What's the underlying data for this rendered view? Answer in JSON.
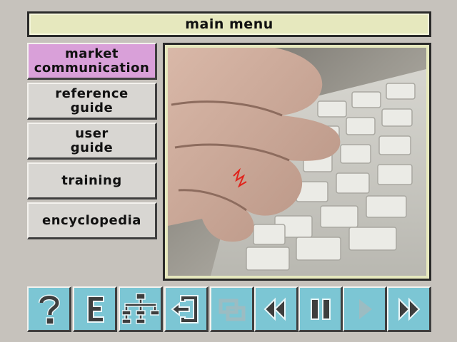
{
  "header": {
    "title": "main menu"
  },
  "menu": {
    "items": [
      {
        "label": "market\ncommunication",
        "selected": true
      },
      {
        "label": "reference\nguide",
        "selected": false
      },
      {
        "label": "user\nguide",
        "selected": false
      },
      {
        "label": "training",
        "selected": false
      },
      {
        "label": "encyclopedia",
        "selected": false
      }
    ]
  },
  "video": {
    "subject": "hand typing on keyboard"
  },
  "toolbar": {
    "buttons": [
      {
        "icon": "help-icon",
        "text": "?",
        "enabled": true
      },
      {
        "icon": "encyclopedia-icon",
        "text": "E",
        "enabled": true
      },
      {
        "icon": "hierarchy-map-icon",
        "enabled": true
      },
      {
        "icon": "exit-icon",
        "enabled": true
      },
      {
        "icon": "overlap-windows-icon",
        "enabled": false
      },
      {
        "icon": "rewind-icon",
        "enabled": true
      },
      {
        "icon": "pause-icon",
        "enabled": true
      },
      {
        "icon": "play-icon",
        "enabled": false
      },
      {
        "icon": "fast-forward-icon",
        "enabled": true
      }
    ]
  },
  "colors": {
    "background": "#c6c2bc",
    "title_fill": "#e6e8be",
    "selected_menu": "#d9a0d9",
    "menu_button": "#d8d6d2",
    "toolbar_button": "#7cc6d4",
    "icon_dark": "#3e3e3e",
    "icon_disabled": "#9cbcc2"
  }
}
